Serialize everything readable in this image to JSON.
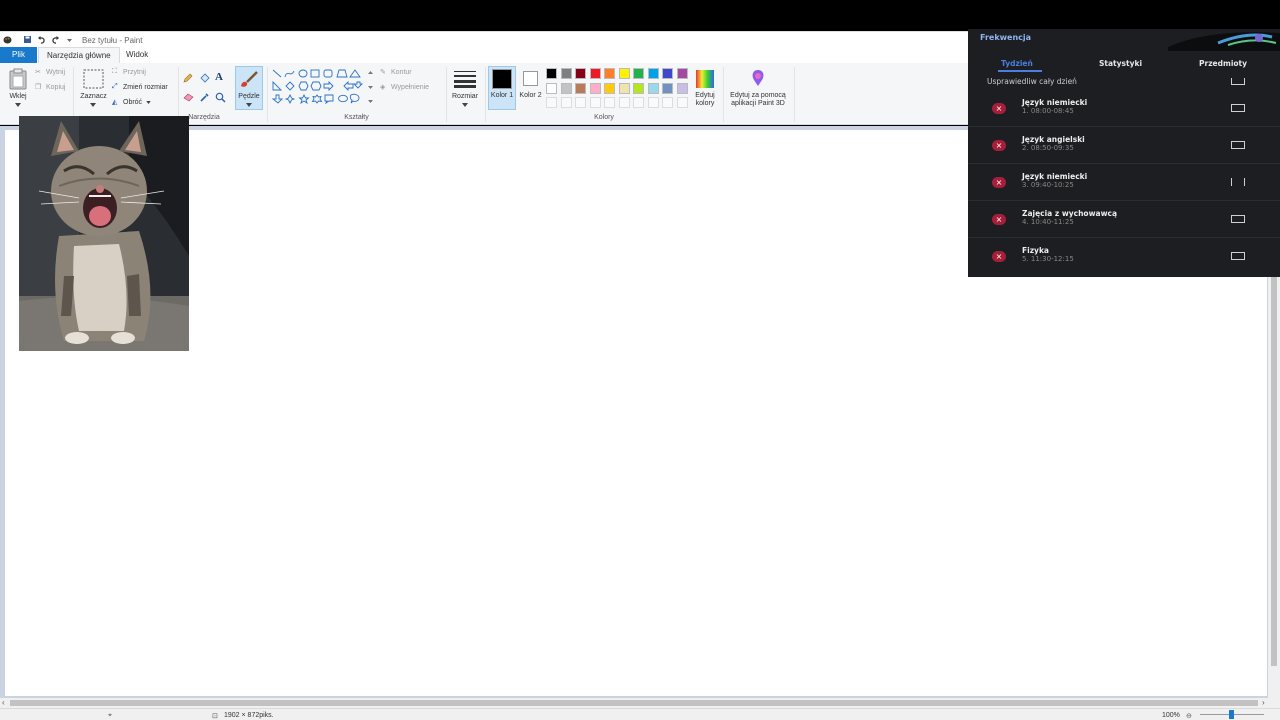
{
  "window": {
    "title": "Bez tytułu - Paint"
  },
  "tabs": {
    "file": "Plik",
    "home": "Narzędzia główne",
    "view": "Widok"
  },
  "ribbon": {
    "clipboard": {
      "paste": "Wklej",
      "cut": "Wytnij",
      "copy": "Kopiuj"
    },
    "image": {
      "select": "Zaznacz",
      "crop": "Przytnij",
      "resize": "Zmień rozmiar",
      "rotate": "Obróć"
    },
    "tools": {
      "label": "Narzędzia"
    },
    "brushes": {
      "label": "Pędzle"
    },
    "shapes": {
      "label": "Kształty",
      "outline": "Kontur",
      "fill": "Wypełnienie"
    },
    "size": {
      "label": "Rozmiar"
    },
    "colors": {
      "color1": "Kolor 1",
      "color2": "Kolor 2",
      "edit": "Edytuj kolory",
      "paint3d": "Edytuj za pomocą aplikacji Paint 3D",
      "group_label": "Kolory",
      "palette_row1": [
        "#000000",
        "#7f7f7f",
        "#880015",
        "#ed1c24",
        "#ff7f27",
        "#fff200",
        "#22b14c",
        "#00a2e8",
        "#3f48cc",
        "#a349a4"
      ],
      "palette_row2": [
        "#ffffff",
        "#c3c3c3",
        "#b97a57",
        "#ffaec9",
        "#ffc90e",
        "#efe4b0",
        "#b5e61d",
        "#99d9ea",
        "#7092be",
        "#c8bfe7"
      ]
    }
  },
  "status": {
    "dimensions": "1902 × 872piks.",
    "zoom": "100%"
  },
  "overlay": {
    "header": "Frekwencja",
    "tabs": [
      "Tydzień",
      "Statystyki",
      "Przedmioty"
    ],
    "excuse_all": "Usprawiedliw cały dzień",
    "lessons": [
      {
        "subject": "Język niemiecki",
        "time": "1. 08:00-08:45"
      },
      {
        "subject": "Język angielski",
        "time": "2. 08:50-09:35"
      },
      {
        "subject": "Język niemiecki",
        "time": "3. 09:40-10:25"
      },
      {
        "subject": "Zajęcia z wychowawcą",
        "time": "4. 10:40-11:25"
      },
      {
        "subject": "Fizyka",
        "time": "5. 11:30-12:15"
      }
    ]
  }
}
